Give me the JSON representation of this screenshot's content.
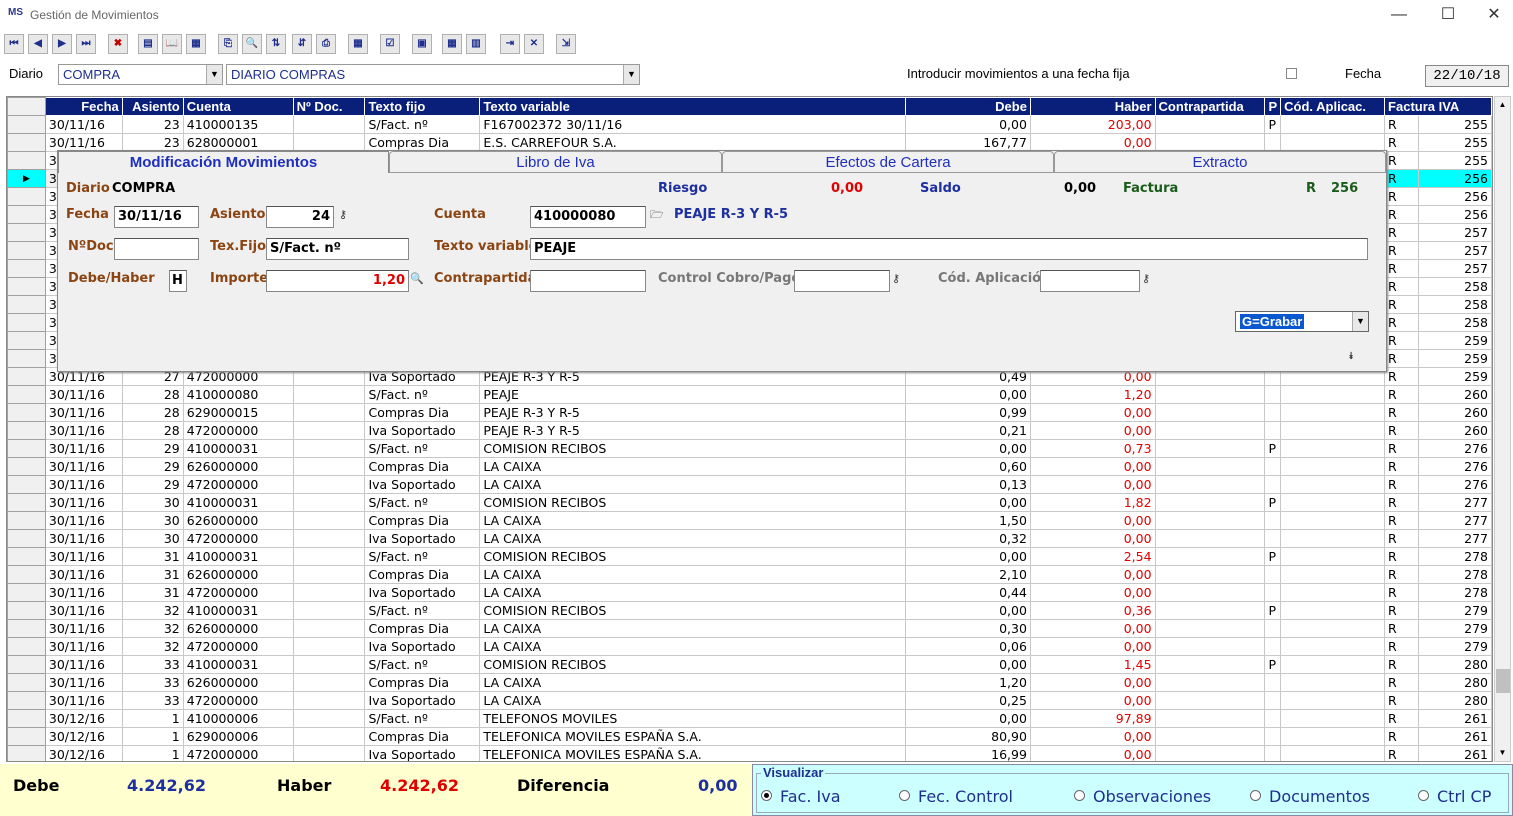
{
  "window": {
    "title": "Gestión de Movimientos",
    "logo": "MS",
    "min": "—",
    "max": "☐",
    "close": "✕"
  },
  "toolbar": {
    "icons": [
      "first-icon",
      "prev-icon",
      "next-icon",
      "last-icon",
      "delete-icon",
      "report-icon",
      "book-icon",
      "invoice-icon",
      "copy-icon",
      "search-icon",
      "sort-asc-icon",
      "sort-desc-icon",
      "print-icon",
      "calculator-icon",
      "check-icon",
      "monitor-icon",
      "calc2-icon",
      "columns-icon",
      "link-icon",
      "cancel-icon",
      "exit-icon"
    ]
  },
  "diario": {
    "label": "Diario",
    "code": "COMPRA",
    "name": "DIARIO COMPRAS",
    "fixed_date_label": "Introducir movimientos a una fecha fija",
    "fecha_label": "Fecha",
    "fecha_value": "22/10/18"
  },
  "grid": {
    "columns": [
      "Fecha",
      "Asiento",
      "Cuenta",
      "Nº Doc.",
      "Texto fijo",
      "Texto variable",
      "Debe",
      "Haber",
      "Contrapartida",
      "P",
      "Cód. Aplicac.",
      "Factura IVA"
    ],
    "rows": [
      [
        "30/11/16",
        "23",
        "410000135",
        "",
        "S/Fact. nº",
        "F167002372  30/11/16",
        "0,00",
        "203,00",
        "",
        "P",
        "",
        "R",
        "255"
      ],
      [
        "30/11/16",
        "23",
        "628000001",
        "",
        "Compras Dia",
        "E.S. CARREFOUR S.A.",
        "167,77",
        "0,00",
        "",
        "",
        "",
        "R",
        "255"
      ],
      [
        "3",
        "",
        "",
        "",
        "",
        "",
        "",
        "",
        "",
        "",
        "",
        "R",
        "255"
      ],
      [
        "3",
        "",
        "",
        "",
        "",
        "",
        "",
        "",
        "",
        "",
        "",
        "R",
        "256"
      ],
      [
        "3",
        "",
        "",
        "",
        "",
        "",
        "",
        "",
        "",
        "",
        "",
        "R",
        "256"
      ],
      [
        "3",
        "",
        "",
        "",
        "",
        "",
        "",
        "",
        "",
        "",
        "",
        "R",
        "256"
      ],
      [
        "3",
        "",
        "",
        "",
        "",
        "",
        "",
        "",
        "",
        "",
        "",
        "R",
        "257"
      ],
      [
        "3",
        "",
        "",
        "",
        "",
        "",
        "",
        "",
        "",
        "",
        "",
        "R",
        "257"
      ],
      [
        "3",
        "",
        "",
        "",
        "",
        "",
        "",
        "",
        "",
        "",
        "",
        "R",
        "257"
      ],
      [
        "3",
        "",
        "",
        "",
        "",
        "",
        "",
        "",
        "",
        "",
        "",
        "R",
        "258"
      ],
      [
        "3",
        "",
        "",
        "",
        "",
        "",
        "",
        "",
        "",
        "",
        "",
        "R",
        "258"
      ],
      [
        "3",
        "",
        "",
        "",
        "",
        "",
        "",
        "",
        "",
        "",
        "",
        "R",
        "258"
      ],
      [
        "3",
        "",
        "",
        "",
        "",
        "",
        "",
        "",
        "",
        "",
        "",
        "R",
        "259"
      ],
      [
        "3",
        "",
        "",
        "",
        "",
        "",
        "",
        "",
        "",
        "",
        "",
        "R",
        "259"
      ],
      [
        "30/11/16",
        "27",
        "472000000",
        "",
        "Iva Soportado",
        "PEAJE R-3 Y R-5",
        "0,49",
        "0,00",
        "",
        "",
        "",
        "R",
        "259"
      ],
      [
        "30/11/16",
        "28",
        "410000080",
        "",
        "S/Fact. nº",
        "PEAJE",
        "0,00",
        "1,20",
        "",
        "",
        "",
        "R",
        "260"
      ],
      [
        "30/11/16",
        "28",
        "629000015",
        "",
        "Compras Dia",
        "PEAJE R-3 Y R-5",
        "0,99",
        "0,00",
        "",
        "",
        "",
        "R",
        "260"
      ],
      [
        "30/11/16",
        "28",
        "472000000",
        "",
        "Iva Soportado",
        "PEAJE R-3 Y R-5",
        "0,21",
        "0,00",
        "",
        "",
        "",
        "R",
        "260"
      ],
      [
        "30/11/16",
        "29",
        "410000031",
        "",
        "S/Fact. nº",
        "COMISION RECIBOS",
        "0,00",
        "0,73",
        "",
        "P",
        "",
        "R",
        "276"
      ],
      [
        "30/11/16",
        "29",
        "626000000",
        "",
        "Compras Dia",
        "LA CAIXA",
        "0,60",
        "0,00",
        "",
        "",
        "",
        "R",
        "276"
      ],
      [
        "30/11/16",
        "29",
        "472000000",
        "",
        "Iva Soportado",
        "LA CAIXA",
        "0,13",
        "0,00",
        "",
        "",
        "",
        "R",
        "276"
      ],
      [
        "30/11/16",
        "30",
        "410000031",
        "",
        "S/Fact. nº",
        "COMISION RECIBOS",
        "0,00",
        "1,82",
        "",
        "P",
        "",
        "R",
        "277"
      ],
      [
        "30/11/16",
        "30",
        "626000000",
        "",
        "Compras Dia",
        "LA CAIXA",
        "1,50",
        "0,00",
        "",
        "",
        "",
        "R",
        "277"
      ],
      [
        "30/11/16",
        "30",
        "472000000",
        "",
        "Iva Soportado",
        "LA CAIXA",
        "0,32",
        "0,00",
        "",
        "",
        "",
        "R",
        "277"
      ],
      [
        "30/11/16",
        "31",
        "410000031",
        "",
        "S/Fact. nº",
        "COMISION RECIBOS",
        "0,00",
        "2,54",
        "",
        "P",
        "",
        "R",
        "278"
      ],
      [
        "30/11/16",
        "31",
        "626000000",
        "",
        "Compras Dia",
        "LA CAIXA",
        "2,10",
        "0,00",
        "",
        "",
        "",
        "R",
        "278"
      ],
      [
        "30/11/16",
        "31",
        "472000000",
        "",
        "Iva Soportado",
        "LA CAIXA",
        "0,44",
        "0,00",
        "",
        "",
        "",
        "R",
        "278"
      ],
      [
        "30/11/16",
        "32",
        "410000031",
        "",
        "S/Fact. nº",
        "COMISION RECIBOS",
        "0,00",
        "0,36",
        "",
        "P",
        "",
        "R",
        "279"
      ],
      [
        "30/11/16",
        "32",
        "626000000",
        "",
        "Compras Dia",
        "LA CAIXA",
        "0,30",
        "0,00",
        "",
        "",
        "",
        "R",
        "279"
      ],
      [
        "30/11/16",
        "32",
        "472000000",
        "",
        "Iva Soportado",
        "LA CAIXA",
        "0,06",
        "0,00",
        "",
        "",
        "",
        "R",
        "279"
      ],
      [
        "30/11/16",
        "33",
        "410000031",
        "",
        "S/Fact. nº",
        "COMISION RECIBOS",
        "0,00",
        "1,45",
        "",
        "P",
        "",
        "R",
        "280"
      ],
      [
        "30/11/16",
        "33",
        "626000000",
        "",
        "Compras Dia",
        "LA CAIXA",
        "1,20",
        "0,00",
        "",
        "",
        "",
        "R",
        "280"
      ],
      [
        "30/11/16",
        "33",
        "472000000",
        "",
        "Iva Soportado",
        "LA CAIXA",
        "0,25",
        "0,00",
        "",
        "",
        "",
        "R",
        "280"
      ],
      [
        "30/12/16",
        "1",
        "410000006",
        "",
        "S/Fact. nº",
        "TELEFONOS MOVILES",
        "0,00",
        "97,89",
        "",
        "",
        "",
        "R",
        "261"
      ],
      [
        "30/12/16",
        "1",
        "629000006",
        "",
        "Compras Dia",
        "TELEFONICA MOVILES ESPAÑA S.A.",
        "80,90",
        "0,00",
        "",
        "",
        "",
        "R",
        "261"
      ],
      [
        "30/12/16",
        "1",
        "472000000",
        "",
        "Iva Soportado",
        "TELEFONICA MOVILES ESPAÑA S.A.",
        "16,99",
        "0,00",
        "",
        "",
        "",
        "R",
        "261"
      ]
    ],
    "selected_row": 3
  },
  "dialog": {
    "tabs": [
      "Modificación Movimientos",
      "Libro de Iva",
      "Efectos de Cartera",
      "Extracto"
    ],
    "diario_label": "Diario",
    "diario_value": "COMPRA",
    "riesgo_label": "Riesgo",
    "riesgo_value": "0,00",
    "saldo_label": "Saldo",
    "saldo_value": "0,00",
    "factura_label": "Factura",
    "factura_serie": "R",
    "factura_num": "256",
    "fecha_label": "Fecha",
    "fecha_value": "30/11/16",
    "asiento_label": "Asiento",
    "asiento_value": "24",
    "cuenta_label": "Cuenta",
    "cuenta_value": "410000080",
    "cuenta_desc": "PEAJE R-3 Y R-5",
    "ndoc_label": "NºDoc",
    "ndoc_value": "",
    "texfijo_label": "Tex.Fijo",
    "texfijo_value": "S/Fact. nº",
    "textovar_label": "Texto variable",
    "textovar_value": "PEAJE",
    "debehaber_label": "Debe/Haber",
    "debehaber_value": "H",
    "importe_label": "Importe",
    "importe_value": "1,20",
    "contrapartida_label": "Contrapartida",
    "contrapartida_value": "",
    "control_label": "Control Cobro/Pago",
    "control_value": "",
    "codaplic_label": "Cód. Aplicación",
    "codaplic_value": "",
    "action_value": "G=Grabar"
  },
  "footer": {
    "debe_label": "Debe",
    "debe_value": "4.242,62",
    "haber_label": "Haber",
    "haber_value": "4.242,62",
    "dif_label": "Diferencia",
    "dif_value": "0,00"
  },
  "visualizar": {
    "legend": "Visualizar",
    "options": [
      "Fac. Iva",
      "Fec. Control",
      "Observaciones",
      "Documentos",
      "Ctrl CP"
    ],
    "selected": 0
  },
  "colors": {
    "header_bg": "#0a1f7a",
    "selected_row": "#00ffff",
    "haber_red": "#e00000",
    "footer_bg": "#ffffd0",
    "vis_bg": "#ccffff"
  }
}
